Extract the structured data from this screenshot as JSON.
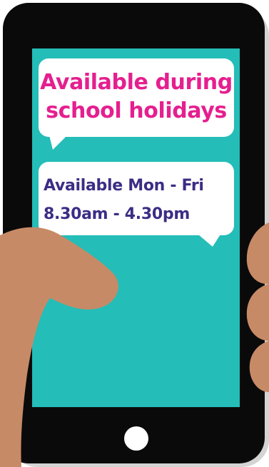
{
  "bubble_top": {
    "line1": "Available during",
    "line2": "school holidays"
  },
  "bubble_bottom": {
    "line1": "Available Mon - Fri",
    "line2": "8.30am - 4.30pm"
  },
  "colors": {
    "screen": "#24bdb8",
    "phone_body": "#0a0a0a",
    "bubble": "#ffffff",
    "headline_text": "#e51f8f",
    "hours_text": "#3b2d85",
    "skin": "#c78a66"
  }
}
